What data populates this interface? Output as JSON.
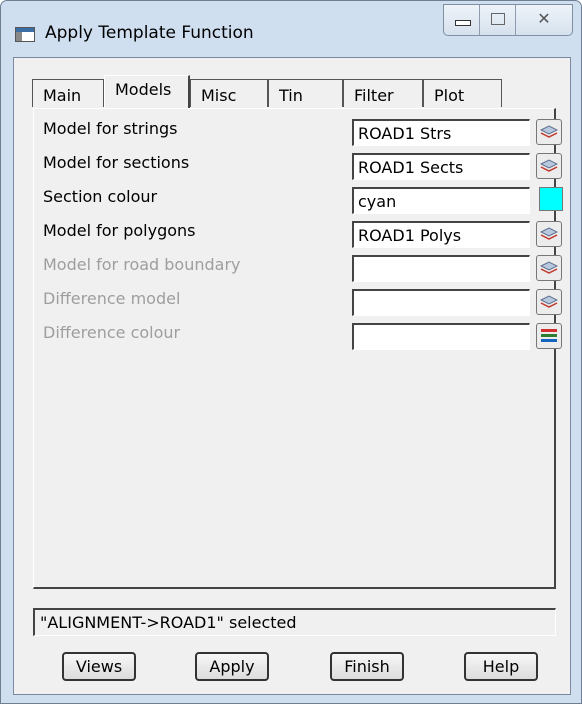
{
  "window": {
    "title": "Apply Template Function",
    "close_glyph": "✕"
  },
  "tabs": [
    {
      "label": "Main",
      "active": false
    },
    {
      "label": "Models",
      "active": true
    },
    {
      "label": "Misc",
      "active": false
    },
    {
      "label": "Tin",
      "active": false
    },
    {
      "label": "Filter",
      "active": false
    },
    {
      "label": "Plot",
      "active": false
    }
  ],
  "fields": [
    {
      "label": "Model for strings",
      "value": "ROAD1 Strs",
      "enabled": true,
      "picker": "layers-icon"
    },
    {
      "label": "Model for sections",
      "value": "ROAD1 Sects",
      "enabled": true,
      "picker": "layers-icon"
    },
    {
      "label": "Section colour",
      "value": "cyan",
      "enabled": true,
      "picker": "color-swatch",
      "swatch_color": "#00ffff"
    },
    {
      "label": "Model for polygons",
      "value": "ROAD1 Polys",
      "enabled": true,
      "picker": "layers-icon"
    },
    {
      "label": "Model for road boundary",
      "value": "",
      "enabled": false,
      "picker": "layers-icon"
    },
    {
      "label": "Difference model",
      "value": "",
      "enabled": false,
      "picker": "layers-icon"
    },
    {
      "label": "Difference colour",
      "value": "",
      "enabled": false,
      "picker": "colour-list-icon"
    }
  ],
  "status": {
    "text": "\"ALIGNMENT->ROAD1\" selected"
  },
  "buttons": {
    "views": "Views",
    "apply": "Apply",
    "finish": "Finish",
    "help": "Help"
  },
  "colors": {
    "frame": "#cfdff0",
    "client": "#f0f0f0",
    "accent_cyan": "#00ffff"
  }
}
